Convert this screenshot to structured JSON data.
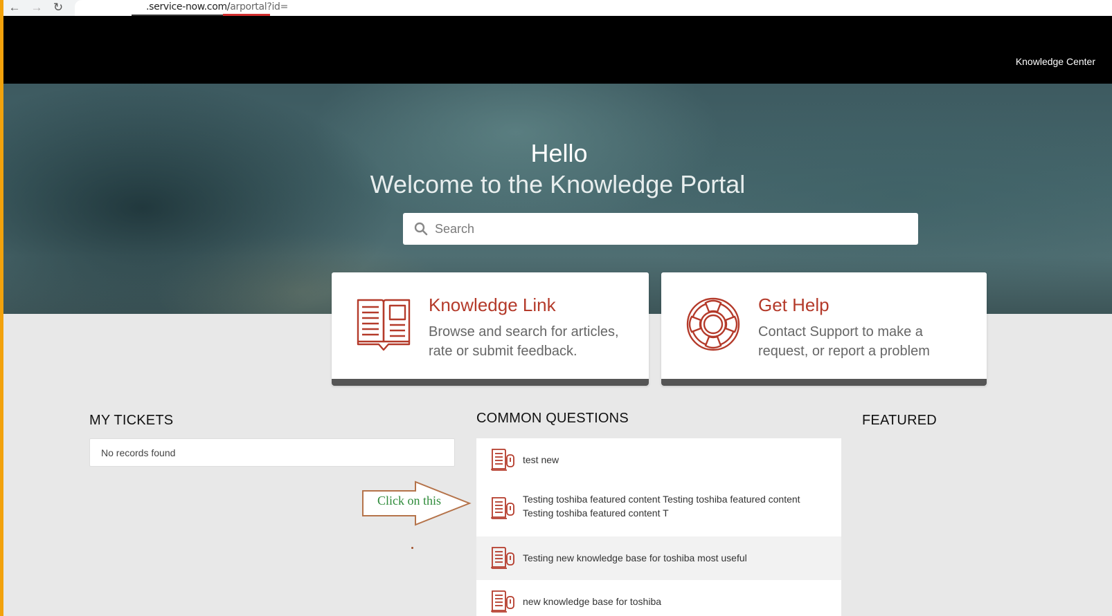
{
  "browser": {
    "url_host": ".service-now.com/",
    "url_path": "arportal?id="
  },
  "header": {
    "nav_link": "Knowledge Center"
  },
  "hero": {
    "greeting": "Hello",
    "subtitle": "Welcome to the Knowledge Portal",
    "search_placeholder": "Search"
  },
  "cards": [
    {
      "title": "Knowledge Link",
      "description": "Browse and search for articles, rate or submit feedback.",
      "icon": "book-icon"
    },
    {
      "title": "Get Help",
      "description": "Contact Support to make a request, or report a problem",
      "icon": "lifebuoy-icon"
    }
  ],
  "my_tickets": {
    "title": "MY TICKETS",
    "empty_text": "No records found"
  },
  "common_questions": {
    "title": "COMMON QUESTIONS",
    "items": [
      {
        "text": "test new"
      },
      {
        "text": "Testing toshiba featured content Testing toshiba featured content Testing toshiba featured content T"
      },
      {
        "text": "Testing new knowledge base for toshiba most useful"
      },
      {
        "text": "new knowledge base for toshiba"
      }
    ]
  },
  "featured": {
    "title": "FEATURED"
  },
  "annotation": {
    "text": "Click on this"
  },
  "colors": {
    "accent": "#b43a2a",
    "header_bg": "#000000",
    "card_bar": "#555555",
    "annotation_text": "#2e8b3a",
    "annotation_arrow": "#b5734a"
  }
}
